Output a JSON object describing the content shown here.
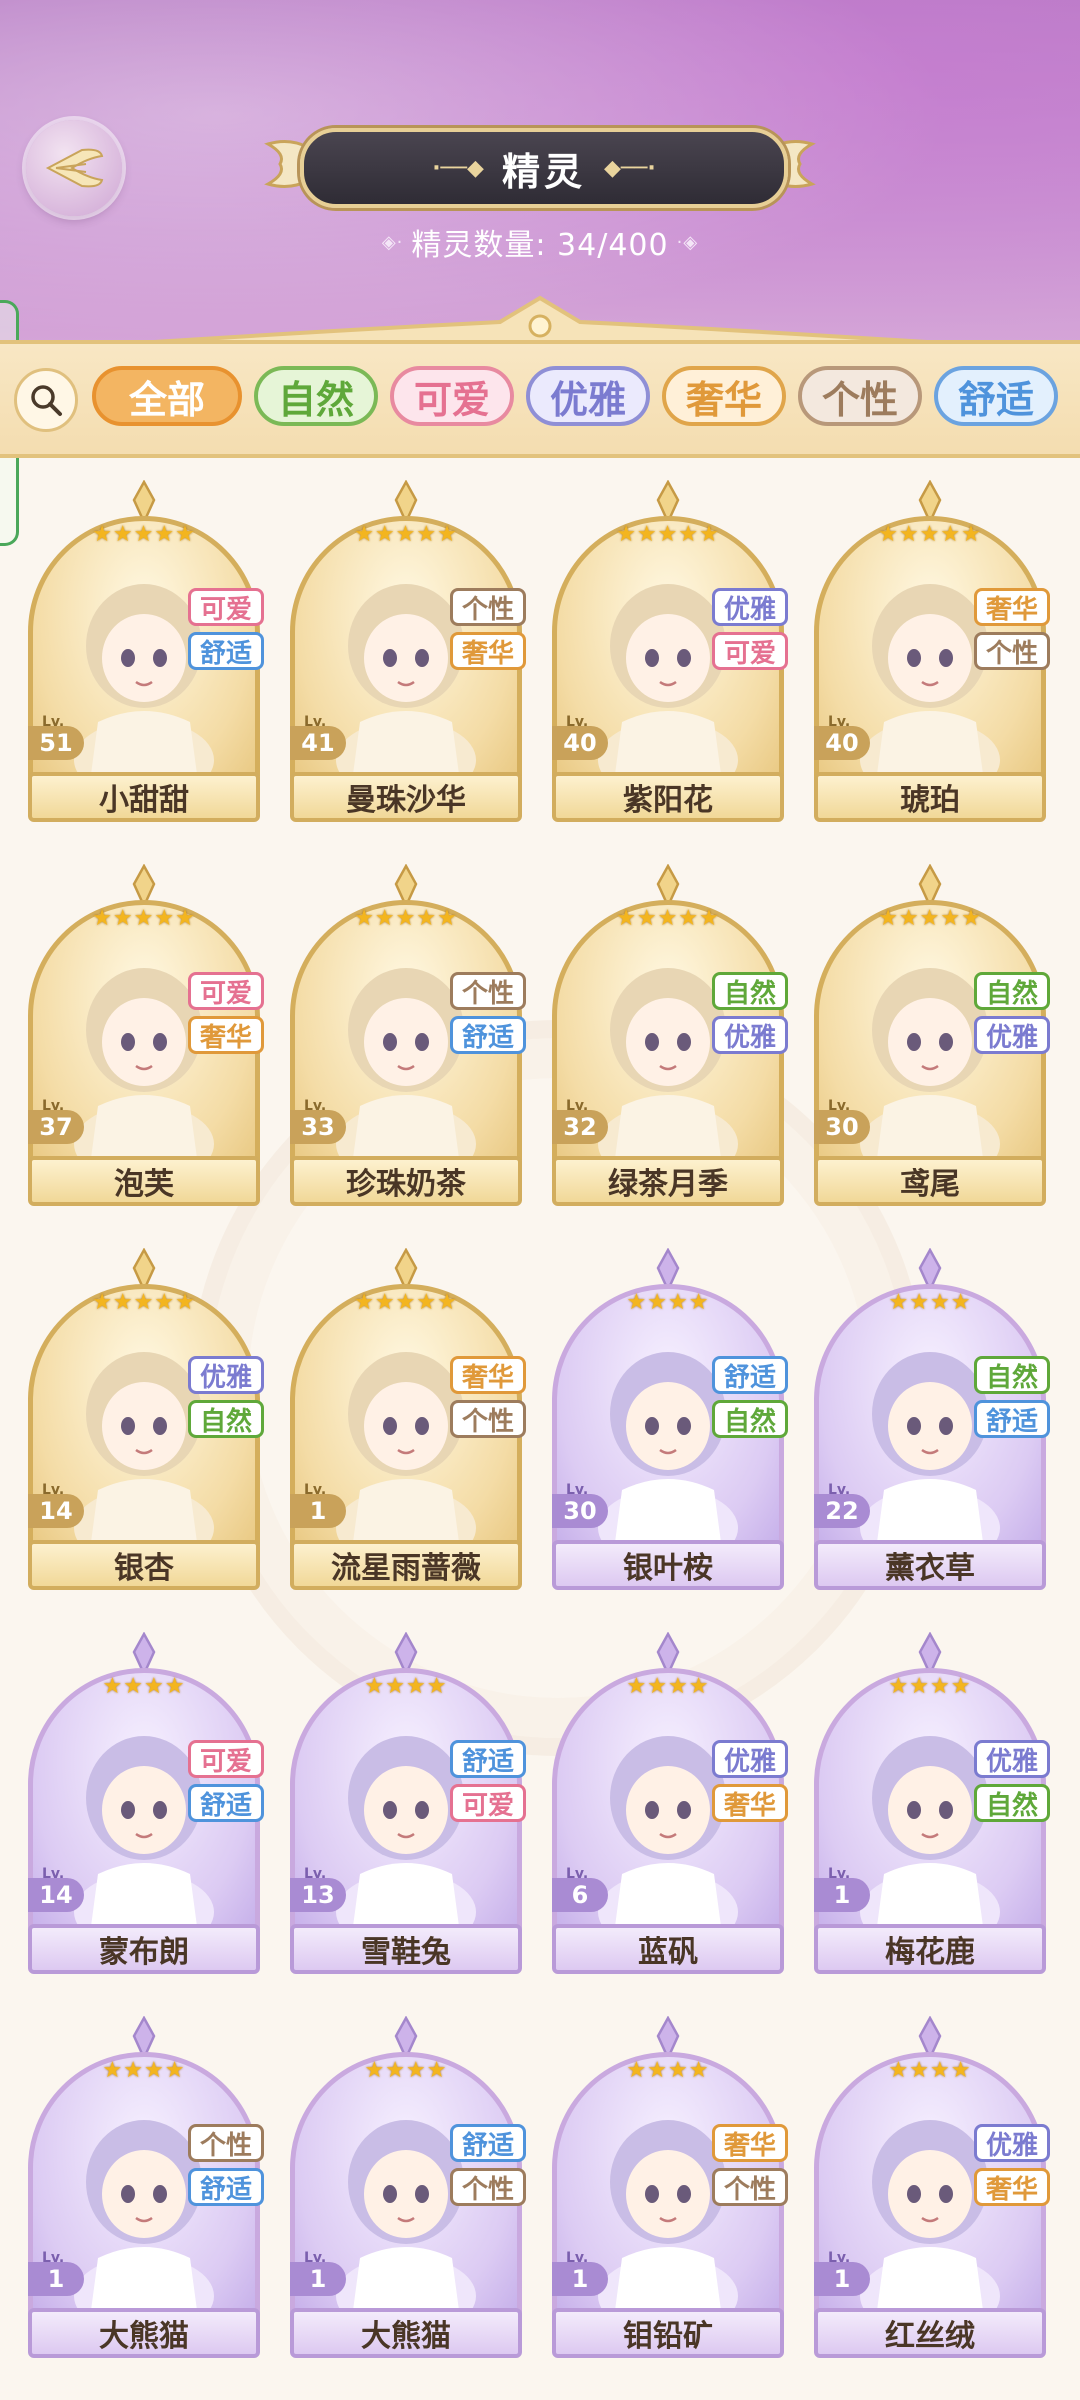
{
  "header": {
    "title": "精灵",
    "count_label": "精灵数量: 34/400"
  },
  "filters": [
    {
      "label": "全部",
      "color": "#e8922f",
      "bg": "#f3b562",
      "text": "#ffffff"
    },
    {
      "label": "自然",
      "color": "#7bb956",
      "bg": "#e6f5d7",
      "text": "#5fa83a"
    },
    {
      "label": "可爱",
      "color": "#e88aa0",
      "bg": "#fde5ec",
      "text": "#e57191"
    },
    {
      "label": "优雅",
      "color": "#8f8fd6",
      "bg": "#ebeafd",
      "text": "#7b7bd0"
    },
    {
      "label": "奢华",
      "color": "#e0a54a",
      "bg": "#fff0d8",
      "text": "#e0993a"
    },
    {
      "label": "个性",
      "color": "#b8987a",
      "bg": "#f3e8de",
      "text": "#9d7c5d"
    },
    {
      "label": "舒适",
      "color": "#6ba3e0",
      "bg": "#e3f0fd",
      "text": "#4f93dc"
    }
  ],
  "tag_colors": {
    "可爱": "#e57191",
    "舒适": "#4f93dc",
    "个性": "#9d7c5d",
    "奢华": "#e0993a",
    "优雅": "#7b7bd0",
    "自然": "#5fa83a"
  },
  "spirits": [
    {
      "name": "小甜甜",
      "level": "51",
      "stars": "★★★★★",
      "tags": [
        "可爱",
        "舒适"
      ],
      "rarity": "gold"
    },
    {
      "name": "曼珠沙华",
      "level": "41",
      "stars": "★★★★★",
      "tags": [
        "个性",
        "奢华"
      ],
      "rarity": "gold"
    },
    {
      "name": "紫阳花",
      "level": "40",
      "stars": "★★★★★",
      "tags": [
        "优雅",
        "可爱"
      ],
      "rarity": "gold"
    },
    {
      "name": "琥珀",
      "level": "40",
      "stars": "★★★★★",
      "tags": [
        "奢华",
        "个性"
      ],
      "rarity": "gold"
    },
    {
      "name": "泡芙",
      "level": "37",
      "stars": "★★★★★",
      "tags": [
        "可爱",
        "奢华"
      ],
      "rarity": "gold"
    },
    {
      "name": "珍珠奶茶",
      "level": "33",
      "stars": "★★★★★",
      "tags": [
        "个性",
        "舒适"
      ],
      "rarity": "gold"
    },
    {
      "name": "绿茶月季",
      "level": "32",
      "stars": "★★★★★",
      "tags": [
        "自然",
        "优雅"
      ],
      "rarity": "gold"
    },
    {
      "name": "鸢尾",
      "level": "30",
      "stars": "★★★★★",
      "tags": [
        "自然",
        "优雅"
      ],
      "rarity": "gold"
    },
    {
      "name": "银杏",
      "level": "14",
      "stars": "★★★★★",
      "tags": [
        "优雅",
        "自然"
      ],
      "rarity": "gold"
    },
    {
      "name": "流星雨蔷薇",
      "level": "1",
      "stars": "★★★★★",
      "tags": [
        "奢华",
        "个性"
      ],
      "rarity": "gold"
    },
    {
      "name": "银叶桉",
      "level": "30",
      "stars": "★★★★",
      "tags": [
        "舒适",
        "自然"
      ],
      "rarity": "purple"
    },
    {
      "name": "薰衣草",
      "level": "22",
      "stars": "★★★★",
      "tags": [
        "自然",
        "舒适"
      ],
      "rarity": "purple"
    },
    {
      "name": "蒙布朗",
      "level": "14",
      "stars": "★★★★",
      "tags": [
        "可爱",
        "舒适"
      ],
      "rarity": "purple"
    },
    {
      "name": "雪鞋兔",
      "level": "13",
      "stars": "★★★★",
      "tags": [
        "舒适",
        "可爱"
      ],
      "rarity": "purple"
    },
    {
      "name": "蓝矾",
      "level": "6",
      "stars": "★★★★",
      "tags": [
        "优雅",
        "奢华"
      ],
      "rarity": "purple"
    },
    {
      "name": "梅花鹿",
      "level": "1",
      "stars": "★★★★",
      "tags": [
        "优雅",
        "自然"
      ],
      "rarity": "purple"
    },
    {
      "name": "大熊猫",
      "level": "1",
      "stars": "★★★★",
      "tags": [
        "个性",
        "舒适"
      ],
      "rarity": "purple"
    },
    {
      "name": "大熊猫",
      "level": "1",
      "stars": "★★★★",
      "tags": [
        "舒适",
        "个性"
      ],
      "rarity": "purple"
    },
    {
      "name": "钼铅矿",
      "level": "1",
      "stars": "★★★★",
      "tags": [
        "奢华",
        "个性"
      ],
      "rarity": "purple"
    },
    {
      "name": "红丝绒",
      "level": "1",
      "stars": "★★★★",
      "tags": [
        "优雅",
        "奢华"
      ],
      "rarity": "purple"
    }
  ],
  "level_prefix": "Lv.",
  "icons": {
    "back": "back-wing-icon",
    "search": "search-icon"
  }
}
